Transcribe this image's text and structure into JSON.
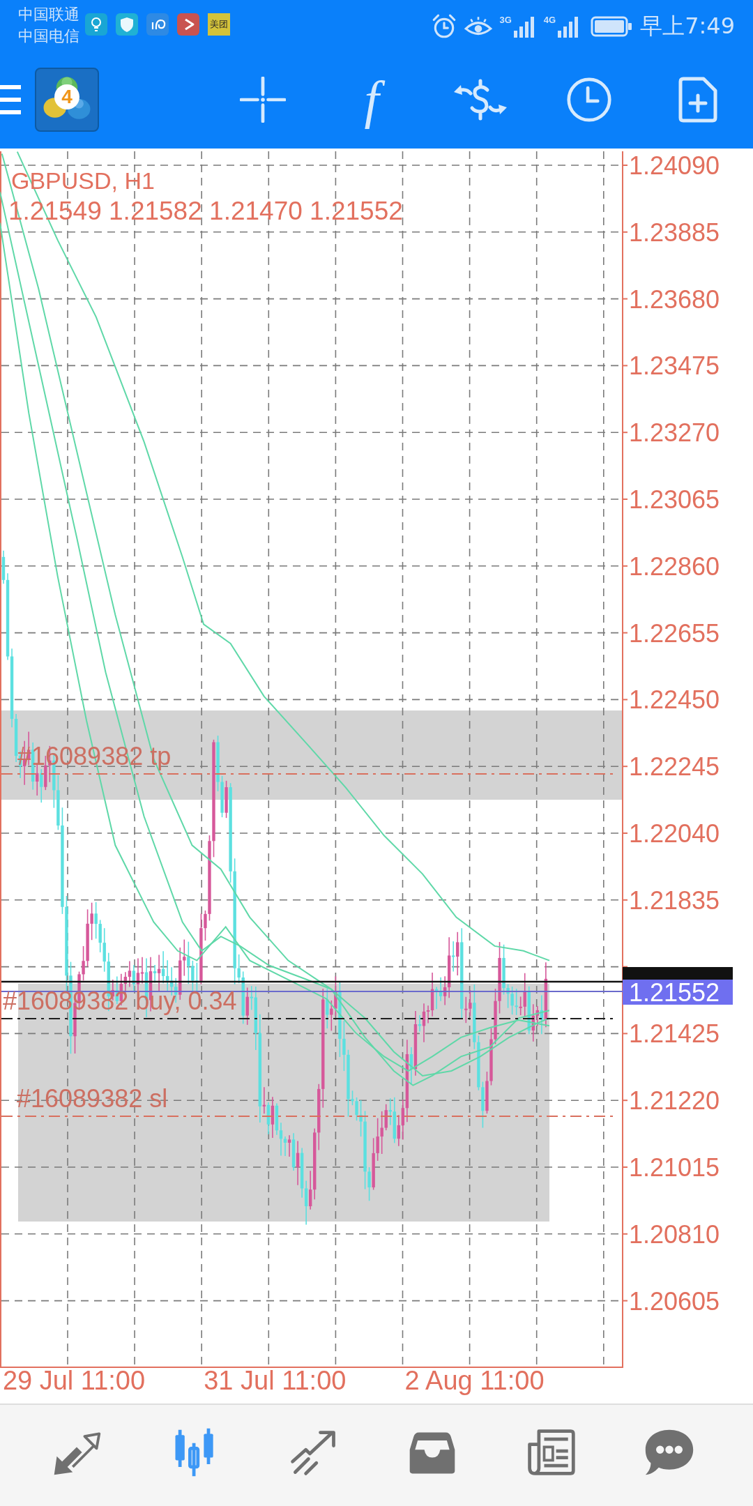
{
  "status_bar": {
    "carriers": [
      "中国联通",
      "中国电信"
    ],
    "app_badge": "美团",
    "networks": [
      {
        "label": "3G"
      },
      {
        "label": "4G"
      }
    ],
    "time": "早上7:49"
  },
  "toolbar": {
    "logo_badge": "4",
    "function_glyph": "f"
  },
  "chart": {
    "symbol": "GBPUSD, H1",
    "ohlc": "1.21549 1.21582 1.21470 1.21552",
    "price_axis": {
      "upper_labels": [
        "1.24090",
        "1.23885",
        "1.23680",
        "1.23475",
        "1.23270",
        "1.23065",
        "1.22860",
        "1.22655",
        "1.22450",
        "1.22245",
        "1.22040",
        "1.21835"
      ],
      "lower_labels": [
        "1.21425",
        "1.21220",
        "1.21015",
        "1.20810",
        "1.20605"
      ]
    },
    "last_price_tag": "1.21552",
    "orders": [
      {
        "kind": "tp",
        "label": "#16089382 tp"
      },
      {
        "kind": "open",
        "label": "#16089382 buy, 0.34"
      },
      {
        "kind": "sl",
        "label": "#16089382 sl"
      }
    ],
    "time_axis": [
      "29 Jul 11:00",
      "31 Jul 11:00",
      "2 Aug 11:00"
    ]
  },
  "bottom_nav": {
    "items": [
      {
        "kind": "quotes",
        "selected": false
      },
      {
        "kind": "chart",
        "selected": true
      },
      {
        "kind": "trade",
        "selected": false
      },
      {
        "kind": "history",
        "selected": false
      },
      {
        "kind": "news",
        "selected": false
      },
      {
        "kind": "chat",
        "selected": false
      }
    ]
  }
}
